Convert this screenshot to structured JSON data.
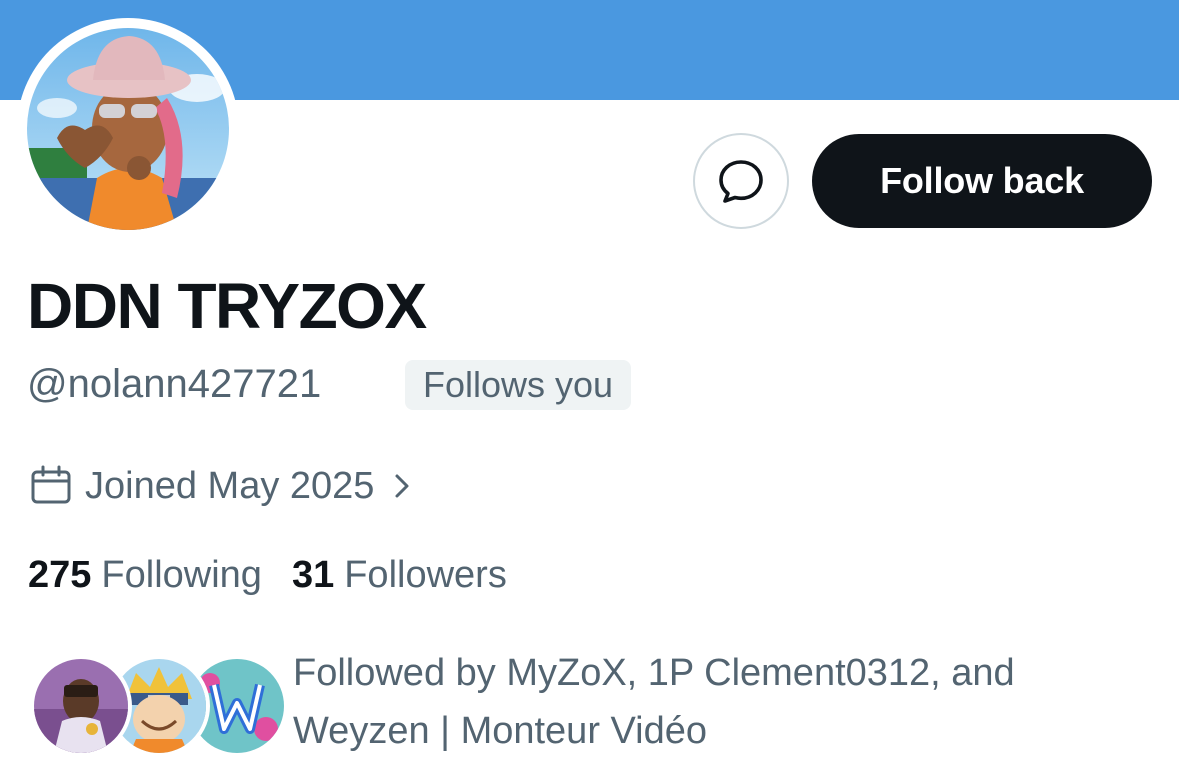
{
  "profile": {
    "display_name": "DDN TRYZOX",
    "handle": "@nolann427721",
    "follows_you_badge": "Follows you",
    "joined": "Joined May 2025"
  },
  "actions": {
    "message_icon": "message-bubble-icon",
    "follow_back_label": "Follow back"
  },
  "stats": {
    "following_count": "275",
    "following_label": "Following",
    "followers_count": "31",
    "followers_label": "Followers"
  },
  "followed_by": {
    "text_line1": "Followed by MyZoX, 1P Clement0312, and",
    "text_line2": "Weyzen | Monteur Vidéo"
  },
  "colors": {
    "banner": "#4a98e0",
    "primary_text": "#0f1419",
    "secondary_text": "#536471",
    "button_bg": "#0f1419"
  }
}
